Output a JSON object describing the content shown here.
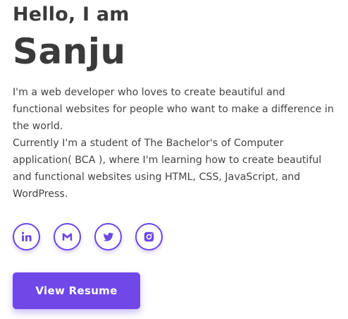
{
  "hero": {
    "greeting": "Hello, I am",
    "name": "Sanju",
    "bio_line1": "I'm a web developer who loves to create beautiful and functional websites for people who want to make a difference in the world.",
    "bio_line2": "Currently I'm a student of The Bachelor's of Computer application( BCA ), where I'm learning how to create beautiful and functional websites using HTML, CSS, JavaScript, and WordPress."
  },
  "socials": [
    {
      "icon": "linkedin-icon"
    },
    {
      "icon": "gmail-icon"
    },
    {
      "icon": "twitter-icon"
    },
    {
      "icon": "instagram-icon"
    }
  ],
  "cta": {
    "resume_label": "View Resume"
  },
  "colors": {
    "accent": "#7048e8",
    "text": "#3a3a3a"
  }
}
